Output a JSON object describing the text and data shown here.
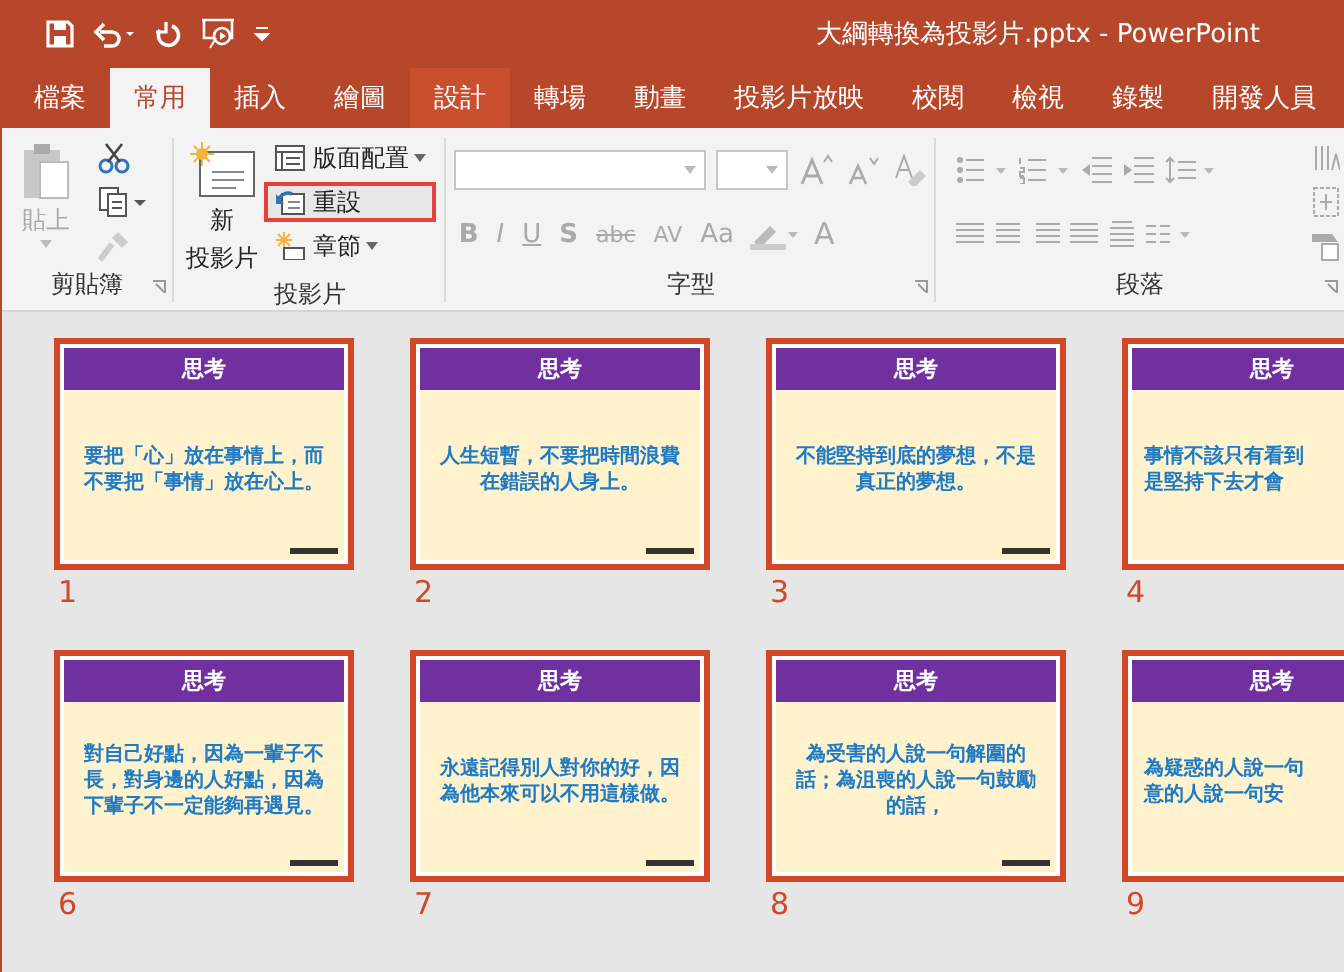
{
  "window": {
    "title": "大綱轉換為投影片.pptx  -  PowerPoint"
  },
  "tabs": [
    {
      "label": "檔案",
      "selected": false,
      "hovered": false
    },
    {
      "label": "常用",
      "selected": true,
      "hovered": false
    },
    {
      "label": "插入",
      "selected": false,
      "hovered": false
    },
    {
      "label": "繪圖",
      "selected": false,
      "hovered": false
    },
    {
      "label": "設計",
      "selected": false,
      "hovered": true
    },
    {
      "label": "轉場",
      "selected": false,
      "hovered": false
    },
    {
      "label": "動畫",
      "selected": false,
      "hovered": false
    },
    {
      "label": "投影片放映",
      "selected": false,
      "hovered": false
    },
    {
      "label": "校閱",
      "selected": false,
      "hovered": false
    },
    {
      "label": "檢視",
      "selected": false,
      "hovered": false
    },
    {
      "label": "錄製",
      "selected": false,
      "hovered": false
    },
    {
      "label": "開發人員",
      "selected": false,
      "hovered": false
    }
  ],
  "clipboard": {
    "label": "剪貼簿",
    "paste": {
      "label": "貼上",
      "disabled": true
    }
  },
  "slides_group": {
    "label": "投影片",
    "new_slide": {
      "label_lines": [
        "新",
        "投影片"
      ]
    },
    "commands": [
      {
        "kind": "layout",
        "label": "版面配置",
        "highlighted": false
      },
      {
        "kind": "reset",
        "label": "重設",
        "highlighted": true
      },
      {
        "kind": "section",
        "label": "章節",
        "highlighted": false
      }
    ]
  },
  "font_group": {
    "label": "字型",
    "buttons": [
      "B",
      "I",
      "U",
      "S",
      "abc",
      "AV",
      "Aa"
    ],
    "color_label": "A"
  },
  "paragraph_group": {
    "label": "段落"
  },
  "slides": [
    {
      "number": "1",
      "title": "思考",
      "body": [
        "要把「心」放在事情上，而不要把「事情」放在心上。"
      ],
      "selected": true
    },
    {
      "number": "2",
      "title": "思考",
      "body": [
        "人生短暫，不要把時間浪費在錯誤的人身上。"
      ],
      "selected": true
    },
    {
      "number": "3",
      "title": "思考",
      "body": [
        "不能堅持到底的夢想，不是真正的夢想。"
      ],
      "selected": true
    },
    {
      "number": "4",
      "title": "思考",
      "body": [
        "事情不該只有看到",
        "是堅持下去才會"
      ],
      "selected": true
    },
    {
      "number": "6",
      "title": "思考",
      "body": [
        "對自己好點，因為一輩子不長，對身邊的人好點，因為下輩子不一定能夠再遇見。"
      ],
      "selected": true
    },
    {
      "number": "7",
      "title": "思考",
      "body": [
        "永遠記得別人對你的好，因為他本來可以不用這樣做。"
      ],
      "selected": true
    },
    {
      "number": "8",
      "title": "思考",
      "body": [
        "為受害的人說一句解圍的話；為沮喪的人說一句鼓勵的話，"
      ],
      "selected": true
    },
    {
      "number": "9",
      "title": "思考",
      "body": [
        "為疑惑的人說一句",
        "意的人說一句安"
      ],
      "selected": true
    }
  ]
}
